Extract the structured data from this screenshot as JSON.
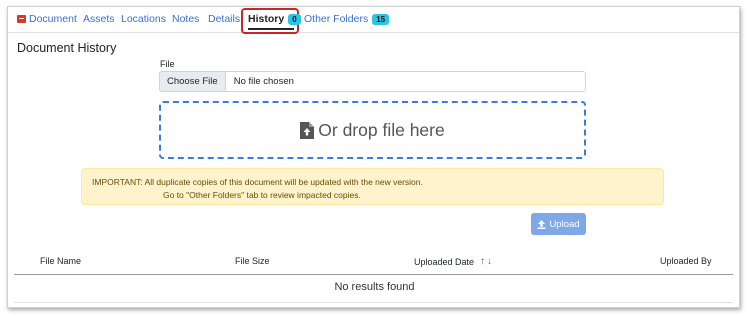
{
  "tabs": {
    "document": "Document",
    "assets": "Assets",
    "locations": "Locations",
    "notes": "Notes",
    "details": "Details",
    "history": "History",
    "history_count": "0",
    "other_folders": "Other Folders",
    "other_folders_count": "15"
  },
  "page": {
    "title": "Document History"
  },
  "file": {
    "label": "File",
    "choose_button": "Choose File",
    "status": "No file chosen"
  },
  "dropzone": {
    "text": "Or drop file here",
    "icon": "file-upload-icon"
  },
  "alert": {
    "line1": "IMPORTANT: All duplicate copies of this document will be updated with the new version.",
    "line2": "Go to \"Other Folders\" tab to review impacted copies."
  },
  "upload": {
    "label": "Upload",
    "icon": "upload-icon"
  },
  "table": {
    "columns": [
      "File Name",
      "File Size",
      "Uploaded Date",
      "Uploaded By"
    ],
    "empty_message": "No results found",
    "sort": {
      "up": "↑",
      "down": "↓"
    }
  },
  "colors": {
    "link": "#3b6fd1",
    "badge": "#2bc3e6",
    "highlight_border": "#c62828",
    "dropzone_border": "#3b7be0",
    "alert_bg": "#fff3cd",
    "upload_bg": "#7fa8e8"
  }
}
